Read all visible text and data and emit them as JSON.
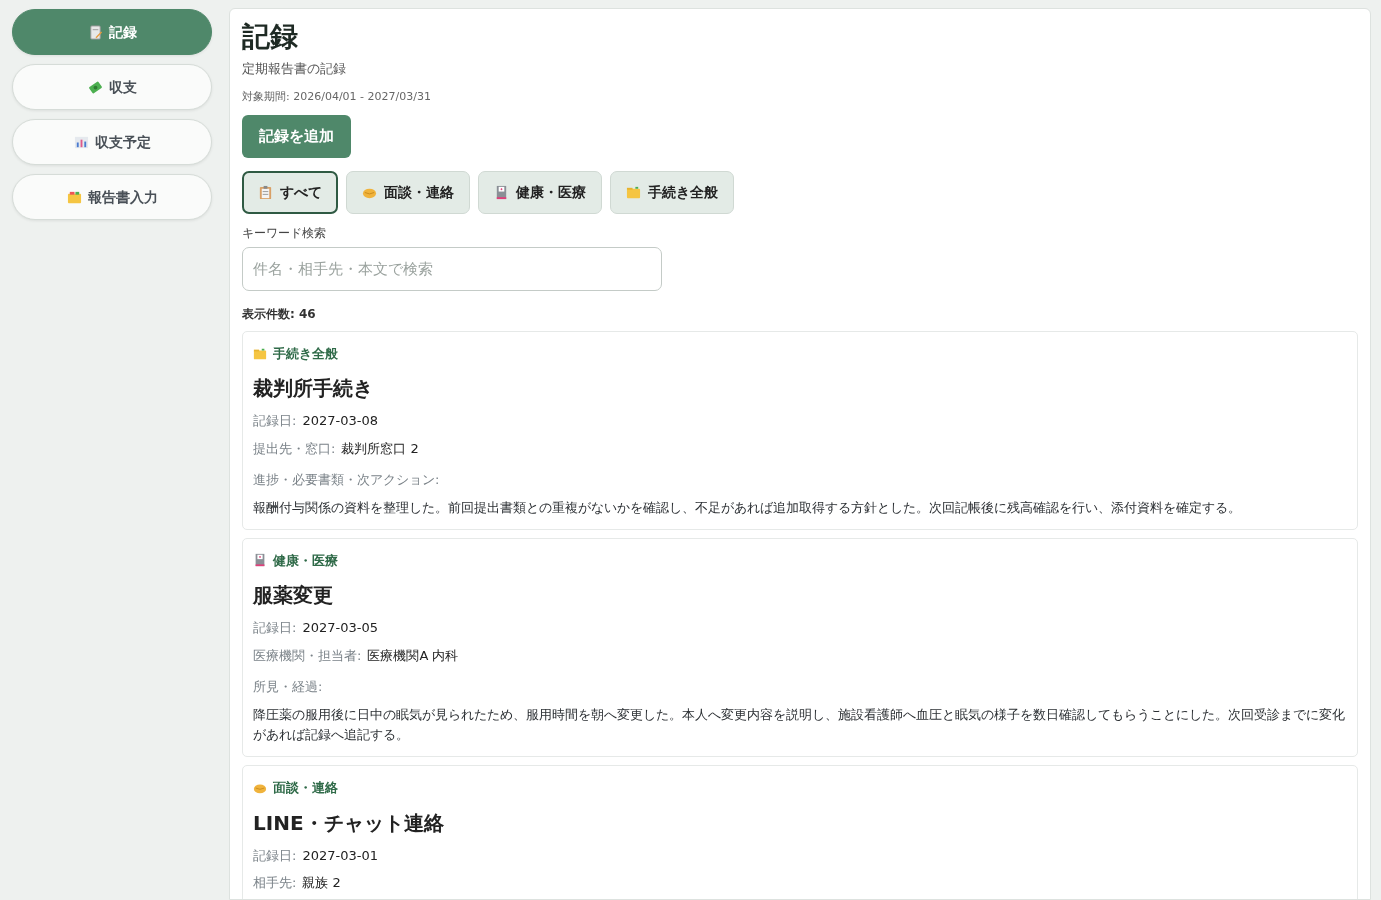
{
  "sidebar": {
    "items": [
      {
        "label": "記録",
        "kind": "records",
        "selected": true
      },
      {
        "label": "収支",
        "kind": "finance",
        "selected": false
      },
      {
        "label": "収支予定",
        "kind": "plan",
        "selected": false
      },
      {
        "label": "報告書入力",
        "kind": "report",
        "selected": false
      }
    ]
  },
  "header": {
    "title": "記録",
    "subtitle": "定期報告書の記録",
    "period": "対象期間: 2026/04/01 - 2027/03/31"
  },
  "add_button": "記録を追加",
  "filters": [
    {
      "label": "すべて",
      "kind": "all",
      "selected": true
    },
    {
      "label": "面談・連絡",
      "kind": "meeting",
      "selected": false
    },
    {
      "label": "健康・医療",
      "kind": "health",
      "selected": false
    },
    {
      "label": "手続き全般",
      "kind": "procedure",
      "selected": false
    }
  ],
  "search": {
    "label": "キーワード検索",
    "placeholder": "件名・相手先・本文で検索"
  },
  "count": "表示件数: 46",
  "records": [
    {
      "category": "手続き全般",
      "kind": "procedure",
      "title": "裁判所手続き",
      "fields": [
        {
          "label": "記録日:",
          "value": "2027-03-08"
        },
        {
          "label": "提出先・窓口:",
          "value": "裁判所窓口 2"
        }
      ],
      "note_label": "進捗・必要書類・次アクション:",
      "note": "報酬付与関係の資料を整理した。前回提出書類との重複がないかを確認し、不足があれば追加取得する方針とした。次回記帳後に残高確認を行い、添付資料を確定する。"
    },
    {
      "category": "健康・医療",
      "kind": "health",
      "title": "服薬変更",
      "fields": [
        {
          "label": "記録日:",
          "value": "2027-03-05"
        },
        {
          "label": "医療機関・担当者:",
          "value": "医療機関A 内科"
        }
      ],
      "note_label": "所見・経過:",
      "note": "降圧薬の服用後に日中の眠気が見られたため、服用時間を朝へ変更した。本人へ変更内容を説明し、施設看護師へ血圧と眠気の様子を数日確認してもらうことにした。次回受診までに変化があれば記録へ追記する。"
    },
    {
      "category": "面談・連絡",
      "kind": "meeting",
      "title": "LINE・チャット連絡",
      "fields": [
        {
          "label": "記録日:",
          "value": "2027-03-01"
        },
        {
          "label": "相手先:",
          "value": "親族 2"
        }
      ]
    }
  ]
}
